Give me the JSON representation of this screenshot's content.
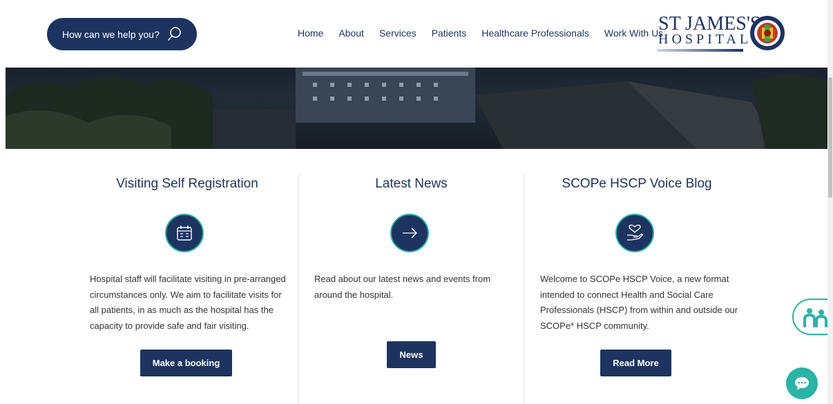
{
  "header": {
    "search_label": "How can we help you?",
    "nav": [
      "Home",
      "About",
      "Services",
      "Patients",
      "Healthcare Professionals",
      "Work With Us"
    ],
    "logo": {
      "line1": "ST JAMES'S",
      "line2": "HOSPITAL"
    }
  },
  "columns": [
    {
      "title": "Visiting Self Registration",
      "icon": "calendar-icon",
      "text": "Hospital staff will facilitate visiting in pre-arranged circumstances only. We aim to facilitate visits for all patients, in as much as the hospital has the capacity to provide safe and fair visiting.",
      "button": "Make a booking"
    },
    {
      "title": "Latest News",
      "icon": "arrow-right-icon",
      "text": "Read about our latest news and events from around the hospital.",
      "button": "News"
    },
    {
      "title": "SCOPe HSCP Voice Blog",
      "icon": "heart-hand-icon",
      "text": "Welcome to SCOPe HSCP Voice, a new format intended to connect Health and Social Care Professionals (HSCP) from within and outside our SCOPe* HSCP community.",
      "button": "Read More"
    }
  ],
  "widgets": {
    "accessibility_icon": "accessibility-people-icon",
    "chat_icon": "chat-bubble-icon"
  },
  "colors": {
    "navy": "#1d3461",
    "teal": "#2bb3a6"
  }
}
